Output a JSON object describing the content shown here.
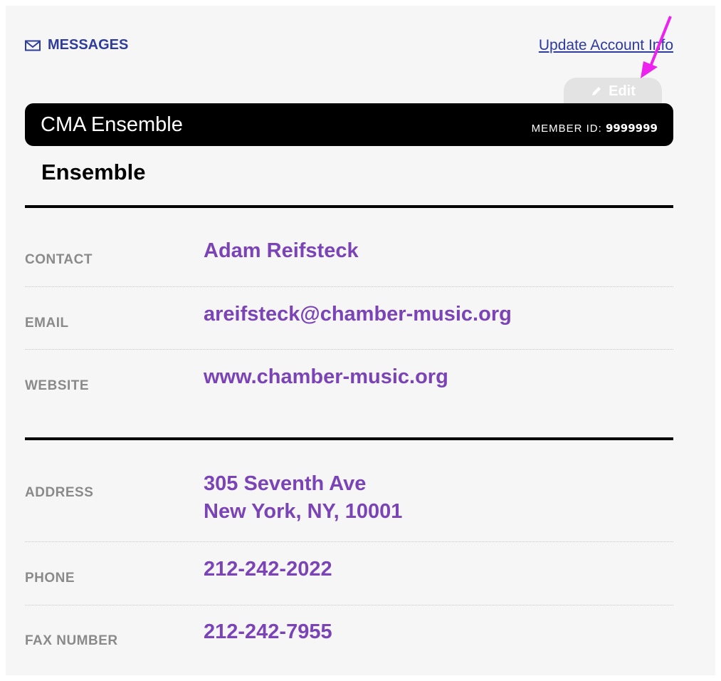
{
  "header": {
    "messages_label": "MESSAGES",
    "update_link": "Update Account Info",
    "edit_label": "Edit"
  },
  "account": {
    "name": "CMA Ensemble",
    "member_id_label": "MEMBER ID:",
    "member_id": "9999999",
    "type": "Ensemble"
  },
  "contact_fields": [
    {
      "label": "CONTACT",
      "value": "Adam Reifsteck"
    },
    {
      "label": "EMAIL",
      "value": "areifsteck@chamber-music.org"
    },
    {
      "label": "WEBSITE",
      "value": "www.chamber-music.org"
    }
  ],
  "address_fields": [
    {
      "label": "ADDRESS",
      "line1": "305 Seventh Ave",
      "line2": "New York, NY, 10001"
    },
    {
      "label": "PHONE",
      "value": "212-242-2022"
    },
    {
      "label": "FAX NUMBER",
      "value": "212-242-7955"
    }
  ],
  "colors": {
    "accent_purple": "#7b44b6",
    "link_blue": "#2d3aa0",
    "annotation_arrow": "#ee22ee"
  },
  "icons": [
    "envelope-icon",
    "pencil-icon"
  ]
}
